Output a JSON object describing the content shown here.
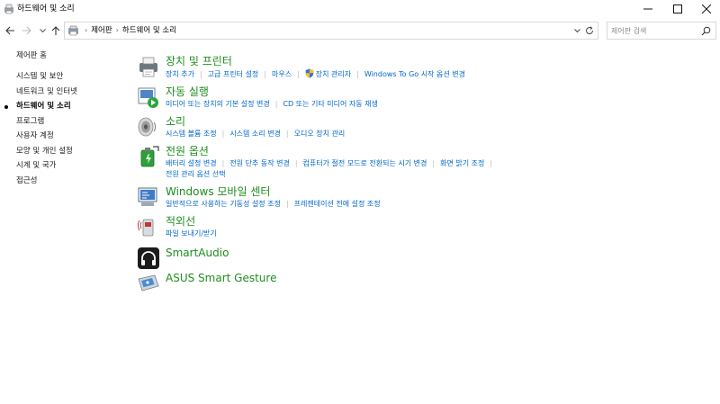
{
  "window": {
    "title": "하드웨어 및 소리",
    "controls": {
      "minimize": "–",
      "maximize": "☐",
      "close": "✕"
    }
  },
  "nav": {
    "breadcrumbs": [
      "제어판",
      "하드웨어 및 소리"
    ],
    "search_placeholder": "제어판 검색"
  },
  "sidebar": {
    "home": "제어판 홈",
    "items": [
      {
        "label": "시스템 및 보안",
        "current": false
      },
      {
        "label": "네트워크 및 인터넷",
        "current": false
      },
      {
        "label": "하드웨어 및 소리",
        "current": true
      },
      {
        "label": "프로그램",
        "current": false
      },
      {
        "label": "사용자 계정",
        "current": false
      },
      {
        "label": "모양 및 개인 설정",
        "current": false
      },
      {
        "label": "시계 및 국가",
        "current": false
      },
      {
        "label": "접근성",
        "current": false
      }
    ]
  },
  "categories": [
    {
      "title": "장치 및 프린터",
      "icon": "printer-icon",
      "links": [
        "장치 추가",
        "고급 프린터 설정",
        "마우스",
        "장치 관리자",
        "Windows To Go 시작 옵션 변경"
      ]
    },
    {
      "title": "자동 실행",
      "icon": "autoplay-icon",
      "links": [
        "미디어 또는 장치의 기본 설정 변경",
        "CD 또는 기타 미디어 자동 재생"
      ]
    },
    {
      "title": "소리",
      "icon": "speaker-icon",
      "links": [
        "시스템 볼륨 조정",
        "시스템 소리 변경",
        "오디오 장치 관리"
      ]
    },
    {
      "title": "전원 옵션",
      "icon": "power-battery-icon",
      "links": [
        "배터리 설정 변경",
        "전원 단추 동작 변경",
        "컴퓨터가 절전 모드로 전환되는 시기 변경",
        "화면 밝기 조정",
        "전원 관리 옵션 선택"
      ]
    },
    {
      "title": "Windows 모바일 센터",
      "icon": "mobility-center-icon",
      "links": [
        "일반적으로 사용하는 기동성 설정 조정",
        "프레젠테이션 전에 설정 조정"
      ]
    },
    {
      "title": "적외선",
      "icon": "infrared-icon",
      "links": [
        "파일 보내기/받기"
      ]
    },
    {
      "title": "SmartAudio",
      "icon": "smartaudio-icon",
      "links": []
    },
    {
      "title": "ASUS Smart Gesture",
      "icon": "touchpad-icon",
      "links": []
    }
  ],
  "colors": {
    "category_title": "#1e8e1e",
    "link": "#0066cc"
  }
}
